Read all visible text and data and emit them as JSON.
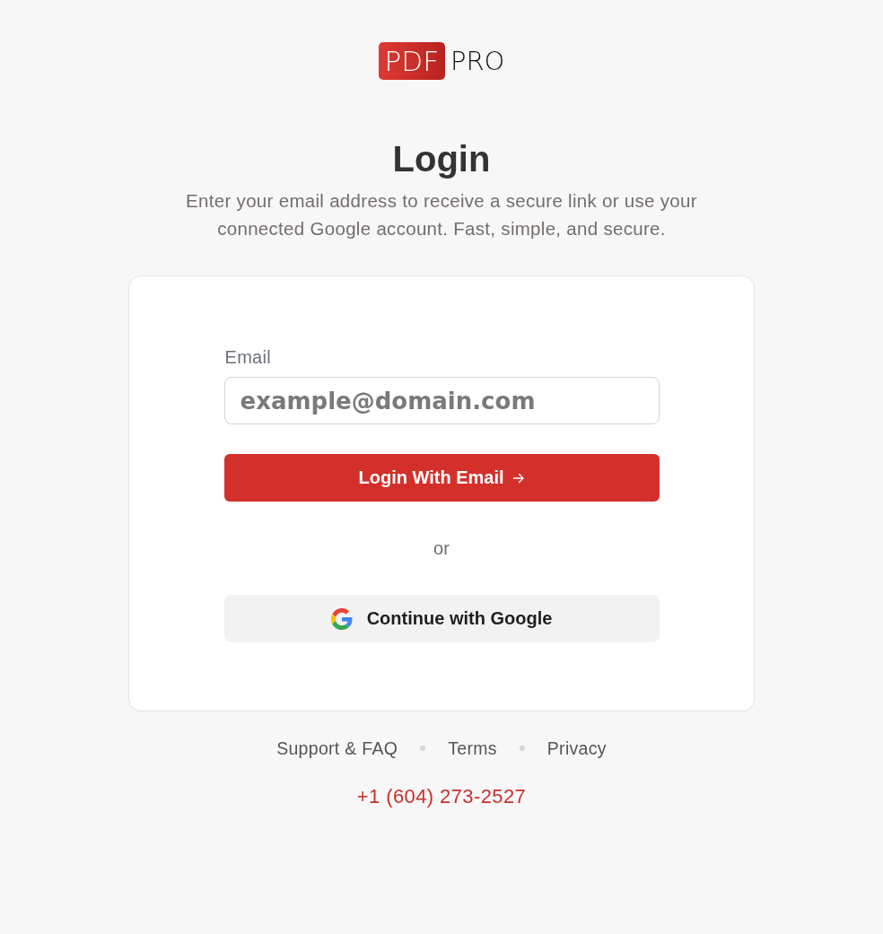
{
  "logo": {
    "badge": "PDF",
    "text": "PRO"
  },
  "heading": {
    "title": "Login",
    "subtitle": "Enter your email address to receive a secure link or use your connected Google account. Fast, simple, and secure."
  },
  "form": {
    "email_label": "Email",
    "email_field": {
      "placeholder": "example@domain.com"
    },
    "submit_button": "Login With Email",
    "divider": "or",
    "google_button": "Continue with Google"
  },
  "footer": {
    "links": [
      "Support & FAQ",
      "Terms",
      "Privacy"
    ],
    "phone": "+1 (604) 273-2527"
  }
}
